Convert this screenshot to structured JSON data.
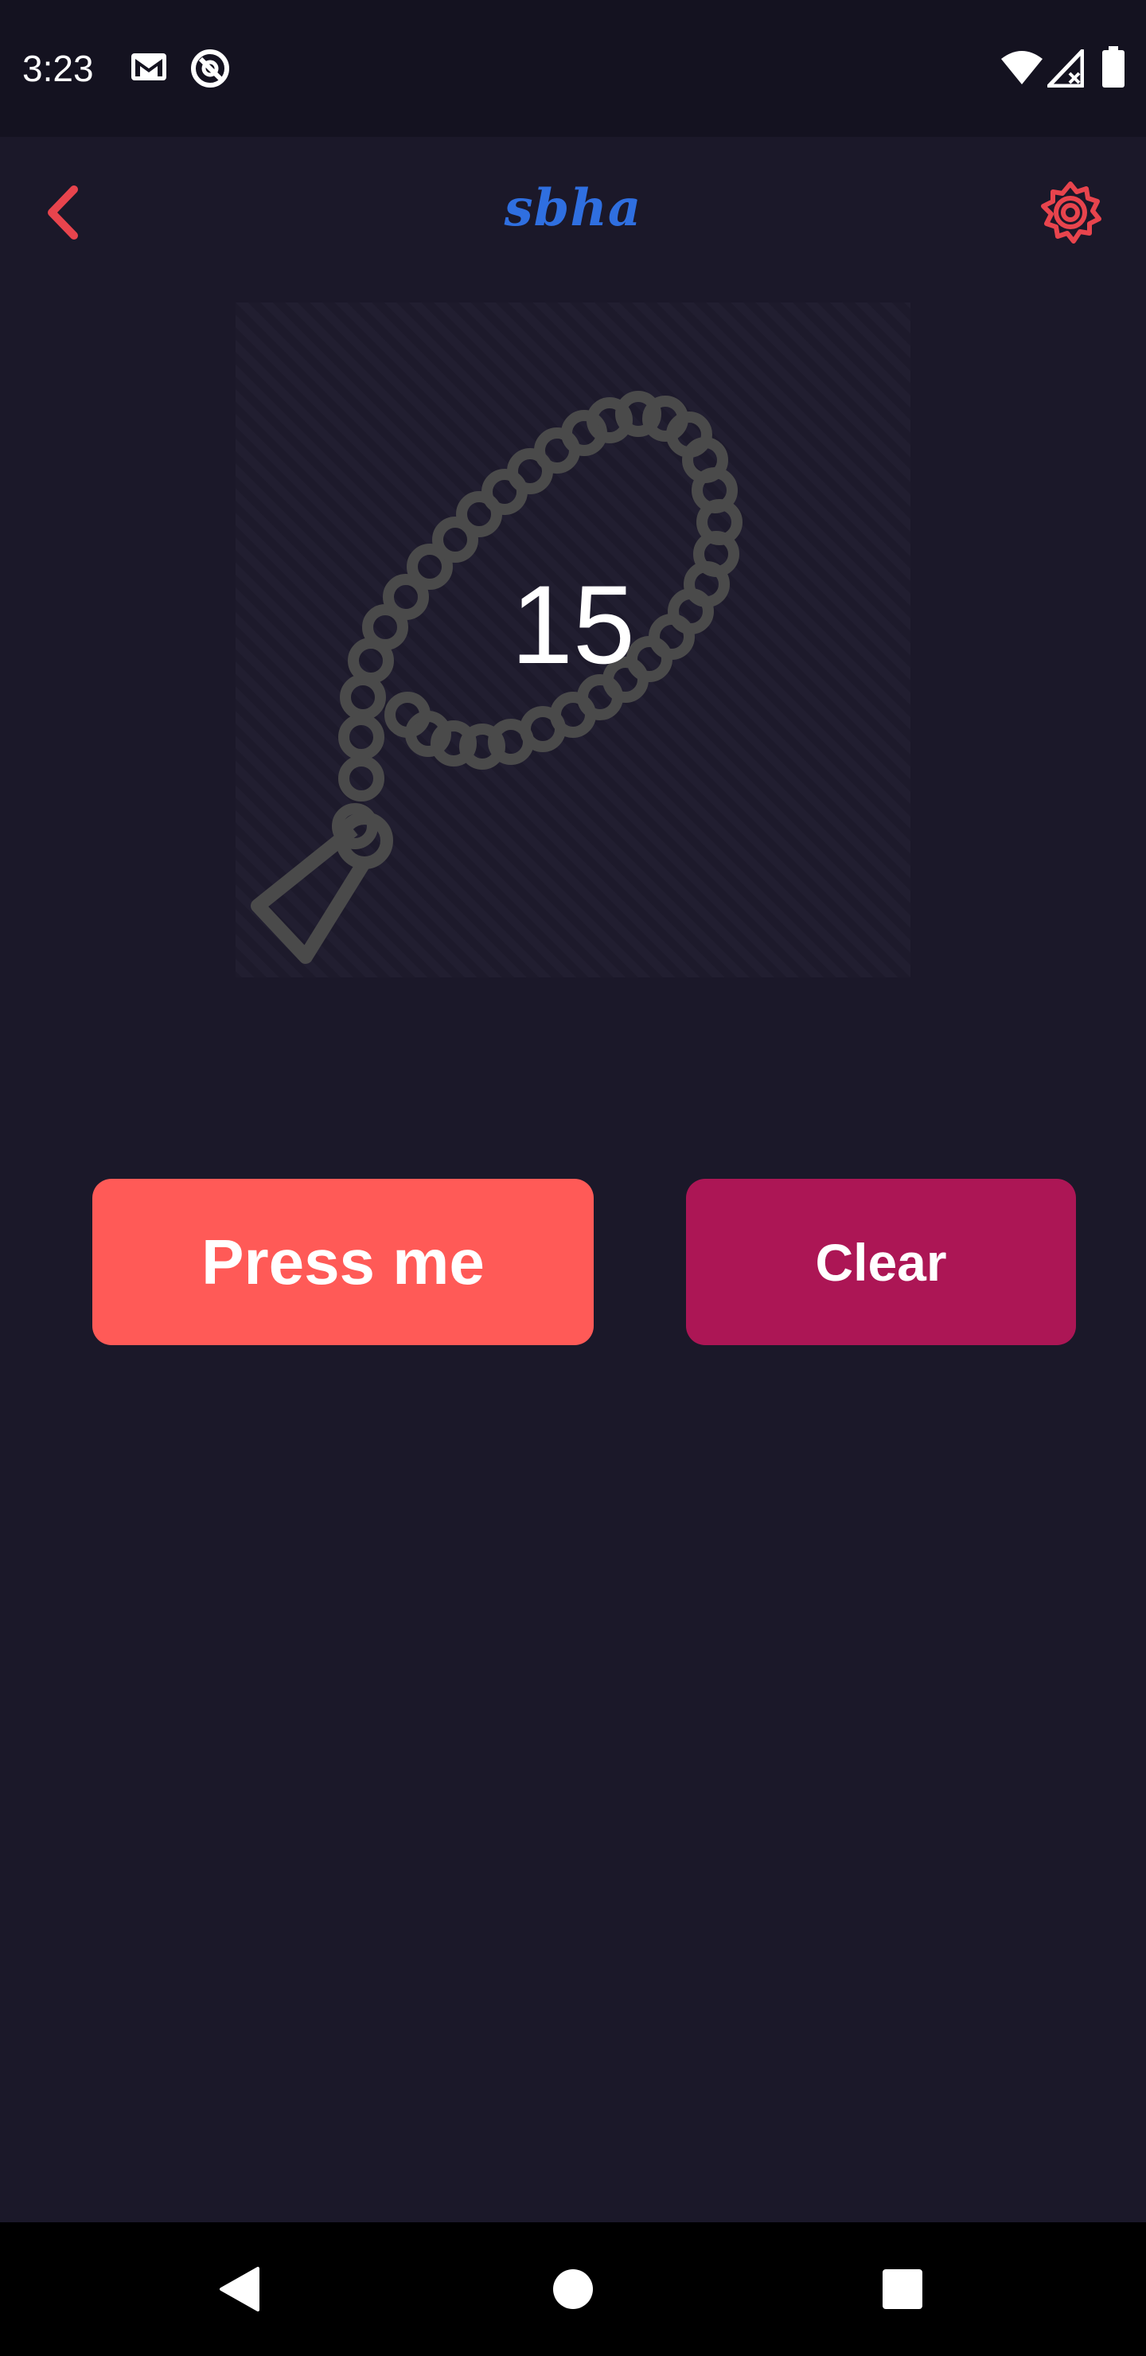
{
  "status_bar": {
    "time": "3:23",
    "icons": [
      "gmail-icon",
      "data-saver-icon",
      "wifi-icon",
      "signal-icon",
      "battery-icon"
    ]
  },
  "header": {
    "title": "sbha",
    "back_icon": "chevron-left-icon",
    "settings_icon": "gear-icon"
  },
  "counter": {
    "value": "15",
    "image": "prayer-beads"
  },
  "buttons": {
    "press_label": "Press me",
    "clear_label": "Clear"
  },
  "nav_bar": {
    "icons": [
      "back-triangle-icon",
      "home-circle-icon",
      "recents-square-icon"
    ]
  },
  "colors": {
    "background": "#1b1829",
    "accent_red": "#ff5a57",
    "clear_magenta": "#ac1655",
    "title_blue": "#2f6fe0",
    "icon_red": "#e8444d",
    "beads_gray": "#4a4a4a"
  }
}
